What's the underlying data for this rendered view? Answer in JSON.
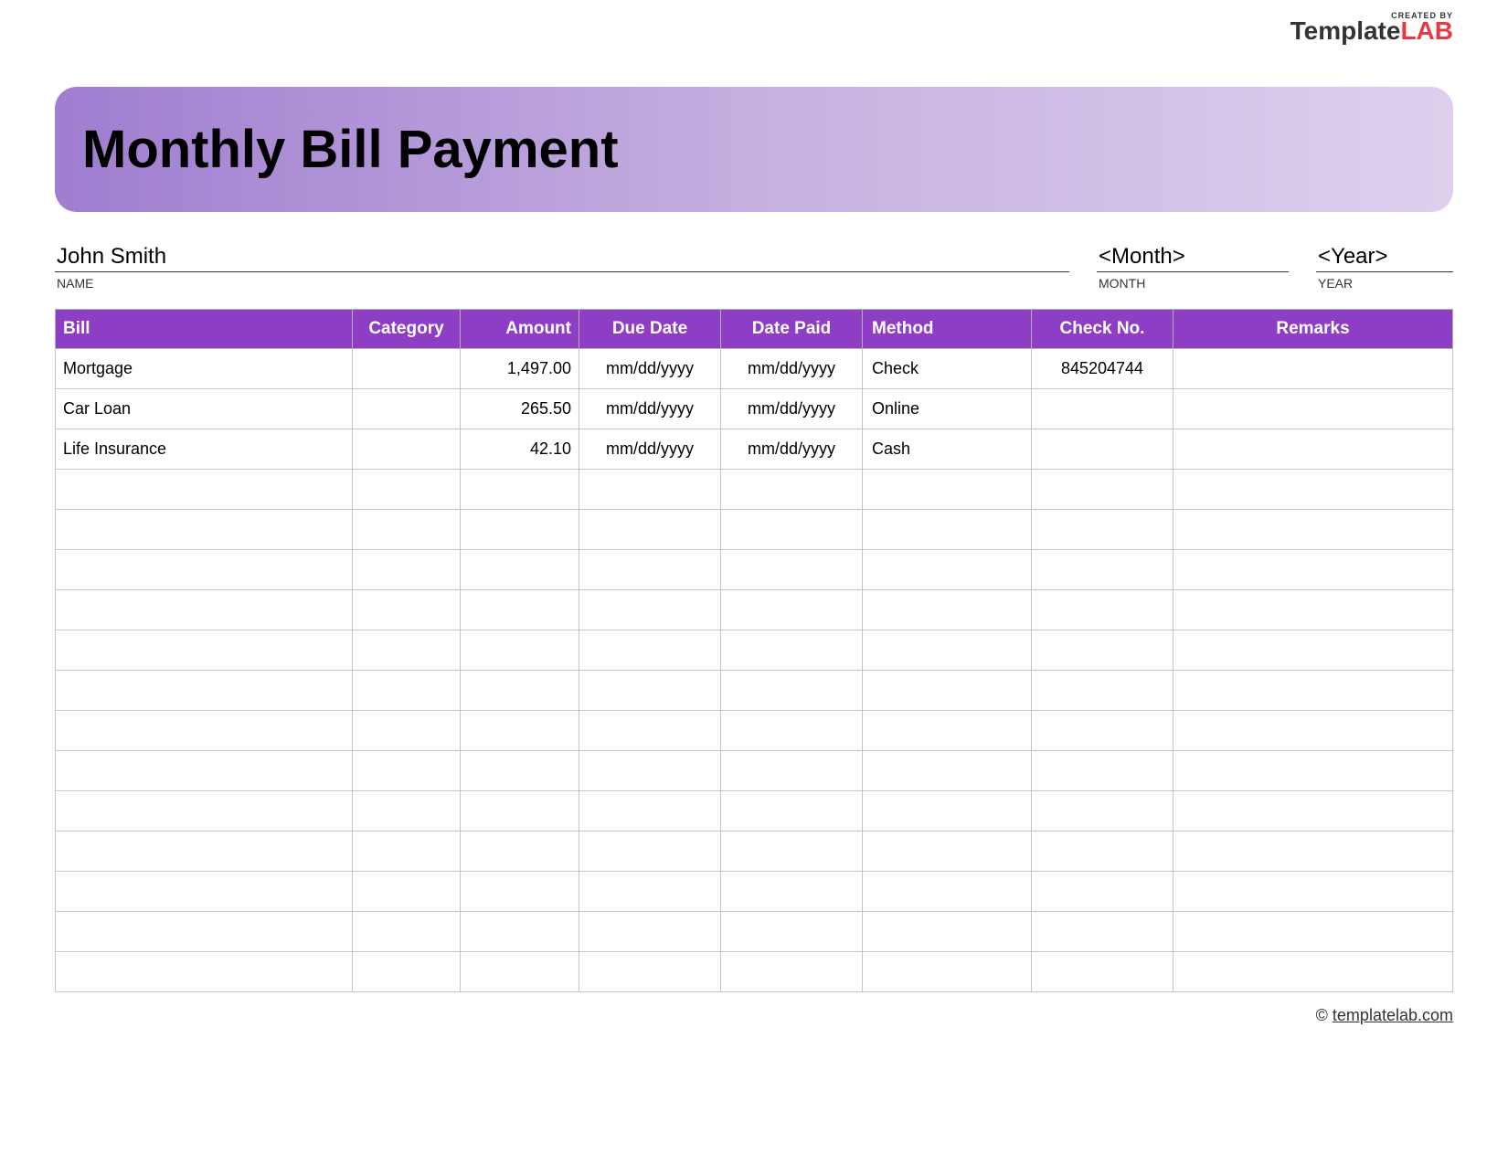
{
  "logo": {
    "created_by": "CREATED BY",
    "template": "Template",
    "lab": "LAB"
  },
  "header": {
    "title": "Monthly Bill Payment"
  },
  "info": {
    "name_value": "John Smith",
    "name_label": "NAME",
    "month_value": "<Month>",
    "month_label": "MONTH",
    "year_value": "<Year>",
    "year_label": "YEAR"
  },
  "table": {
    "headers": {
      "bill": "Bill",
      "category": "Category",
      "amount": "Amount",
      "due_date": "Due Date",
      "date_paid": "Date Paid",
      "method": "Method",
      "check_no": "Check No.",
      "remarks": "Remarks"
    },
    "rows": [
      {
        "bill": "Mortgage",
        "category": "",
        "amount": "1,497.00",
        "due_date": "mm/dd/yyyy",
        "date_paid": "mm/dd/yyyy",
        "method": "Check",
        "check_no": "845204744",
        "remarks": ""
      },
      {
        "bill": "Car Loan",
        "category": "",
        "amount": "265.50",
        "due_date": "mm/dd/yyyy",
        "date_paid": "mm/dd/yyyy",
        "method": "Online",
        "check_no": "",
        "remarks": ""
      },
      {
        "bill": "Life Insurance",
        "category": "",
        "amount": "42.10",
        "due_date": "mm/dd/yyyy",
        "date_paid": "mm/dd/yyyy",
        "method": "Cash",
        "check_no": "",
        "remarks": ""
      },
      {
        "bill": "",
        "category": "",
        "amount": "",
        "due_date": "",
        "date_paid": "",
        "method": "",
        "check_no": "",
        "remarks": ""
      },
      {
        "bill": "",
        "category": "",
        "amount": "",
        "due_date": "",
        "date_paid": "",
        "method": "",
        "check_no": "",
        "remarks": ""
      },
      {
        "bill": "",
        "category": "",
        "amount": "",
        "due_date": "",
        "date_paid": "",
        "method": "",
        "check_no": "",
        "remarks": ""
      },
      {
        "bill": "",
        "category": "",
        "amount": "",
        "due_date": "",
        "date_paid": "",
        "method": "",
        "check_no": "",
        "remarks": ""
      },
      {
        "bill": "",
        "category": "",
        "amount": "",
        "due_date": "",
        "date_paid": "",
        "method": "",
        "check_no": "",
        "remarks": ""
      },
      {
        "bill": "",
        "category": "",
        "amount": "",
        "due_date": "",
        "date_paid": "",
        "method": "",
        "check_no": "",
        "remarks": ""
      },
      {
        "bill": "",
        "category": "",
        "amount": "",
        "due_date": "",
        "date_paid": "",
        "method": "",
        "check_no": "",
        "remarks": ""
      },
      {
        "bill": "",
        "category": "",
        "amount": "",
        "due_date": "",
        "date_paid": "",
        "method": "",
        "check_no": "",
        "remarks": ""
      },
      {
        "bill": "",
        "category": "",
        "amount": "",
        "due_date": "",
        "date_paid": "",
        "method": "",
        "check_no": "",
        "remarks": ""
      },
      {
        "bill": "",
        "category": "",
        "amount": "",
        "due_date": "",
        "date_paid": "",
        "method": "",
        "check_no": "",
        "remarks": ""
      },
      {
        "bill": "",
        "category": "",
        "amount": "",
        "due_date": "",
        "date_paid": "",
        "method": "",
        "check_no": "",
        "remarks": ""
      },
      {
        "bill": "",
        "category": "",
        "amount": "",
        "due_date": "",
        "date_paid": "",
        "method": "",
        "check_no": "",
        "remarks": ""
      },
      {
        "bill": "",
        "category": "",
        "amount": "",
        "due_date": "",
        "date_paid": "",
        "method": "",
        "check_no": "",
        "remarks": ""
      }
    ]
  },
  "footer": {
    "copyright": "©",
    "link_text": "templatelab.com"
  }
}
